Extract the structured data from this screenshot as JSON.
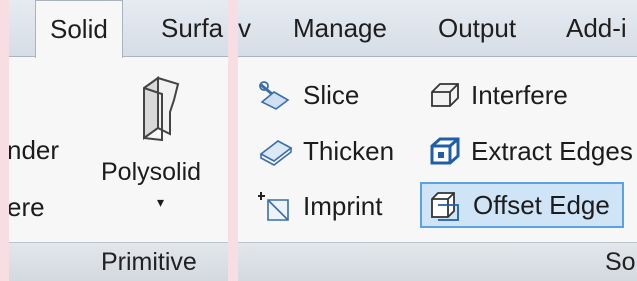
{
  "left_panel": {
    "tabs": {
      "solid": "Solid",
      "surface": "Surfa"
    },
    "cylinder_label": "nder",
    "sphere_label": "ere",
    "polysolid_label": "Polysolid",
    "panel_title": "Primitive"
  },
  "right_panel": {
    "tabs": {
      "view": "v",
      "manage": "Manage",
      "output": "Output",
      "addins": "Add-i"
    },
    "tools": {
      "slice": "Slice",
      "thicken": "Thicken",
      "imprint": "Imprint",
      "interfere": "Interfere",
      "extract_edges": "Extract Edges",
      "offset_edge": "Offset Edge"
    },
    "panel_title": "So"
  },
  "colors": {
    "accent_blue": "#1f5fa8",
    "selection_fill": "#cfe4f7",
    "selection_border": "#5aa2e0"
  }
}
